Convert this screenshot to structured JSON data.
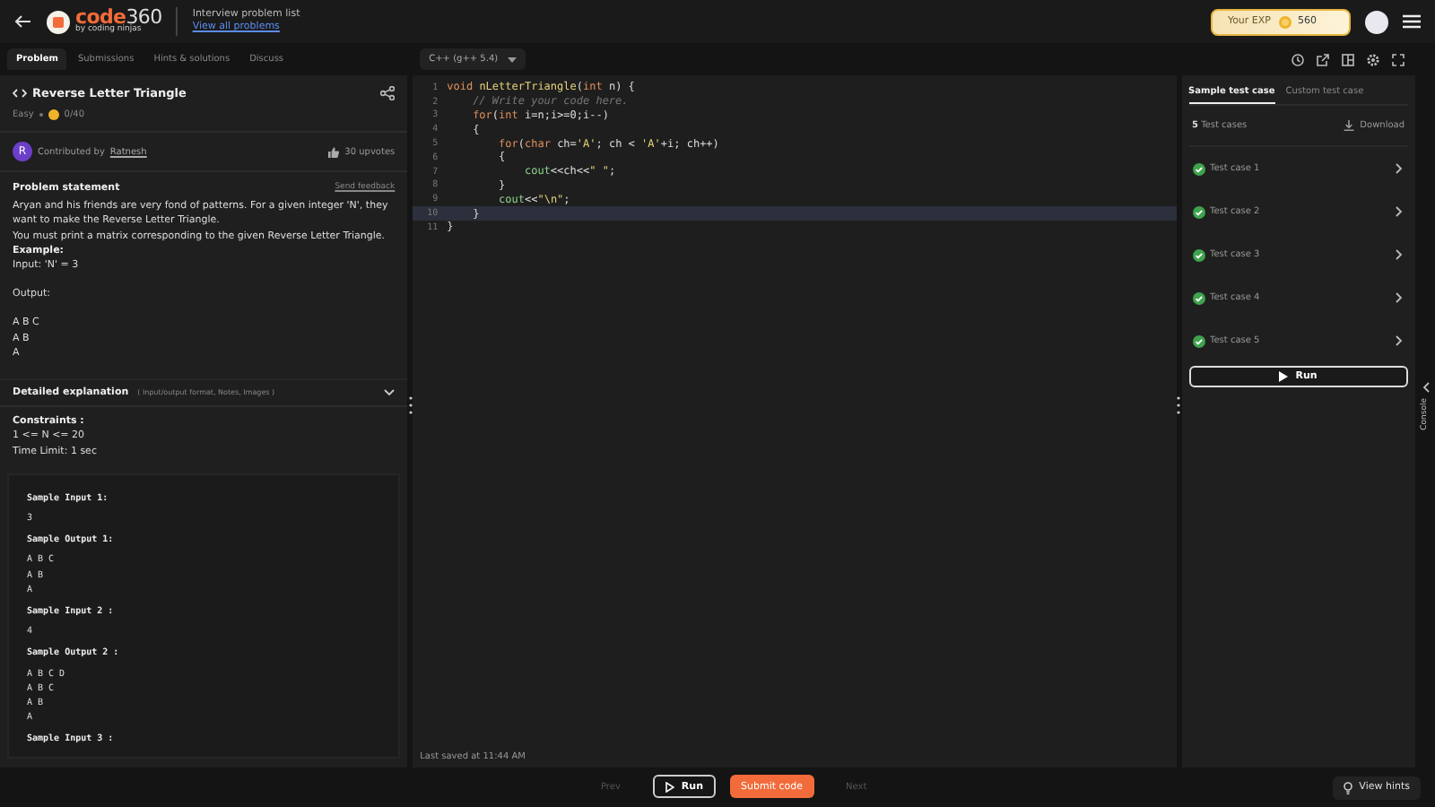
{
  "header": {
    "logo_word": "code",
    "logo_number": "360",
    "logo_byline": "by coding ninjas",
    "breadcrumb": "Interview problem list",
    "breadcrumb_link": "View all problems",
    "exp_label": "Your EXP",
    "exp_value": "560"
  },
  "tabs": [
    {
      "label": "Problem",
      "selected": true
    },
    {
      "label": "Submissions",
      "selected": false
    },
    {
      "label": "Hints & solutions",
      "selected": false
    },
    {
      "label": "Discuss",
      "selected": false
    }
  ],
  "problem": {
    "title": "Reverse Letter Triangle",
    "difficulty": "Easy",
    "score": "0/40",
    "avatar_letter": "R",
    "contributed_label": "Contributed by",
    "contributor": "Ratnesh",
    "upvotes": "30 upvotes",
    "statement_heading": "Problem statement",
    "feedback": "Send feedback",
    "statement": [
      "Aryan and his friends are very fond of patterns. For a given integer 'N', they want to make the Reverse Letter Triangle.",
      "You must print a matrix corresponding to the given Reverse Letter Triangle."
    ],
    "example_heading": "Example:",
    "example_blocks": [
      [
        "Input: 'N' = 3"
      ],
      [
        "Output:"
      ],
      [
        "A B C",
        "A B",
        "A"
      ]
    ],
    "explanation": {
      "title": "Detailed explanation",
      "hint": "( Input/output format, Notes, Images )",
      "expanded": false
    },
    "constraints_heading": "Constraints :",
    "constraints": [
      "1 <= N <= 20",
      "Time Limit: 1 sec"
    ],
    "samples": [
      {
        "kind": "heading",
        "text": "Sample Input 1:"
      },
      {
        "kind": "value",
        "text": "3"
      },
      {
        "kind": "heading",
        "text": "Sample Output 1:"
      },
      {
        "kind": "value",
        "text": "A B C"
      },
      {
        "kind": "value",
        "text": "A B"
      },
      {
        "kind": "value",
        "text": "A"
      },
      {
        "kind": "heading",
        "text": "Sample Input 2 :"
      },
      {
        "kind": "value",
        "text": "4"
      },
      {
        "kind": "heading",
        "text": "Sample Output 2 :"
      },
      {
        "kind": "value",
        "text": "A B C D"
      },
      {
        "kind": "value",
        "text": "A B C"
      },
      {
        "kind": "value",
        "text": "A B"
      },
      {
        "kind": "value",
        "text": "A"
      },
      {
        "kind": "heading",
        "text": "Sample Input 3 :"
      }
    ]
  },
  "editor": {
    "language": "C++ (g++ 5.4)",
    "saved": "Last saved at 11:44 AM",
    "lines": [
      {
        "number": "1",
        "active": false,
        "tokens": [
          {
            "kind": "keyword",
            "text": "void "
          },
          {
            "kind": "function",
            "text": "nLetterTriangle"
          },
          {
            "kind": "plain",
            "text": "("
          },
          {
            "kind": "keyword",
            "text": "int"
          },
          {
            "kind": "plain",
            "text": " n) {"
          }
        ]
      },
      {
        "number": "2",
        "active": false,
        "tokens": [
          {
            "kind": "comment",
            "text": "    // Write your code here."
          }
        ]
      },
      {
        "number": "3",
        "active": false,
        "tokens": [
          {
            "kind": "keyword",
            "text": "    for"
          },
          {
            "kind": "plain",
            "text": "("
          },
          {
            "kind": "keyword",
            "text": "int"
          },
          {
            "kind": "plain",
            "text": " i=n;i>=0;i--)"
          }
        ]
      },
      {
        "number": "4",
        "active": false,
        "tokens": [
          {
            "kind": "plain",
            "text": "    {"
          }
        ]
      },
      {
        "number": "5",
        "active": false,
        "tokens": [
          {
            "kind": "keyword",
            "text": "        for"
          },
          {
            "kind": "plain",
            "text": "("
          },
          {
            "kind": "keyword",
            "text": "char"
          },
          {
            "kind": "plain",
            "text": " ch="
          },
          {
            "kind": "string",
            "text": "'A'"
          },
          {
            "kind": "plain",
            "text": "; ch < "
          },
          {
            "kind": "string",
            "text": "'A'"
          },
          {
            "kind": "plain",
            "text": "+i; ch++)"
          }
        ]
      },
      {
        "number": "6",
        "active": false,
        "tokens": [
          {
            "kind": "plain",
            "text": "        {"
          }
        ]
      },
      {
        "number": "7",
        "active": false,
        "tokens": [
          {
            "kind": "call",
            "text": "            cout"
          },
          {
            "kind": "plain",
            "text": "<<ch<<"
          },
          {
            "kind": "string",
            "text": "\" \""
          },
          {
            "kind": "plain",
            "text": ";"
          }
        ]
      },
      {
        "number": "8",
        "active": false,
        "tokens": [
          {
            "kind": "plain",
            "text": "        }"
          }
        ]
      },
      {
        "number": "9",
        "active": false,
        "tokens": [
          {
            "kind": "call",
            "text": "        cout"
          },
          {
            "kind": "plain",
            "text": "<<"
          },
          {
            "kind": "string",
            "text": "\"\\n\""
          },
          {
            "kind": "plain",
            "text": ";"
          }
        ]
      },
      {
        "number": "10",
        "active": true,
        "tokens": [
          {
            "kind": "plain",
            "text": "    }"
          }
        ]
      },
      {
        "number": "11",
        "active": false,
        "tokens": [
          {
            "kind": "plain",
            "text": "}"
          }
        ]
      }
    ]
  },
  "tests": {
    "tabs": [
      {
        "label": "Sample test case",
        "selected": true
      },
      {
        "label": "Custom test case",
        "selected": false
      }
    ],
    "count": "**5** Test cases",
    "download": "Download",
    "cases": [
      {
        "label": "Test case 1",
        "passed": true
      },
      {
        "label": "Test case 2",
        "passed": true
      },
      {
        "label": "Test case 3",
        "passed": true
      },
      {
        "label": "Test case 4",
        "passed": true
      },
      {
        "label": "Test case 5",
        "passed": true
      }
    ],
    "run": "Run"
  },
  "console_label": "Console",
  "footer": {
    "prev": {
      "label": "Prev",
      "disabled": true
    },
    "run": "Run",
    "submit": "Submit code",
    "next": {
      "label": "Next",
      "disabled": true
    },
    "hints": "View hints"
  }
}
